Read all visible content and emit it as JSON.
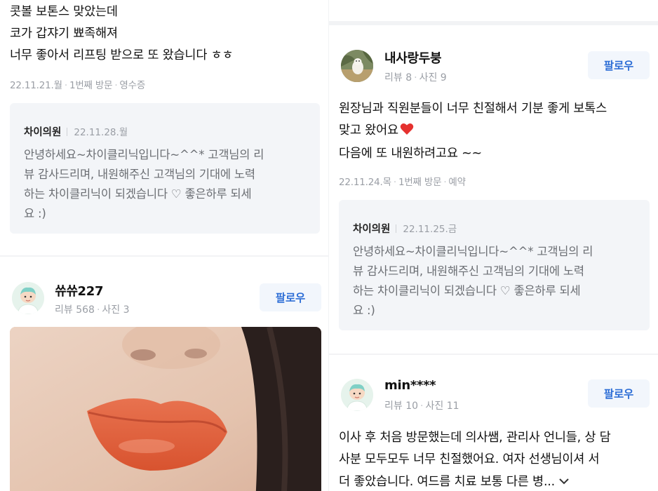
{
  "left": {
    "review1": {
      "lines": [
        "콧볼 보톤스 맞았는데",
        "코가 갑쟈기 뾰족해져",
        "너무 좋아서 리프팅 받으로 또 왔습니다 ㅎㅎ"
      ],
      "date": "22.11.21.월",
      "visit": "1번째 방문",
      "receipt": "영수증",
      "reply": {
        "author": "차이의원",
        "date": "22.11.28.월",
        "lines": [
          "안녕하세요~차이클리닉입니다~^^* 고객님의 리",
          "뷰 감사드리며, 내원해주신 고객님의 기대에 노력",
          "하는 차이클리닉이 되겠습니다 ♡ 좋은하루 되세",
          "요 :)"
        ]
      }
    },
    "reviewer2": {
      "name": "쓔쓔227",
      "reviews": "리뷰 568",
      "photos": "사진 3",
      "follow": "팔로우",
      "avatar_icon": "default-avatar-icon"
    }
  },
  "right": {
    "reviewer1": {
      "name": "내사랑두붕",
      "reviews": "리뷰 8",
      "photos": "사진 9",
      "follow": "팔로우",
      "avatar_icon": "dog-photo-avatar",
      "lines": [
        "원장님과 직원분들이 너무 친절해서 기분 좋게 보톡스",
        "맞고 왔어요",
        "다음에 또 내원하려고요 ~~"
      ],
      "date": "22.11.24.목",
      "visit": "1번째 방문",
      "booking": "예약",
      "reply": {
        "author": "차이의원",
        "date": "22.11.25.금",
        "lines": [
          "안녕하세요~차이클리닉입니다~^^* 고객님의 리",
          "뷰 감사드리며, 내원해주신 고객님의 기대에 노력",
          "하는 차이클리닉이 되겠습니다 ♡ 좋은하루 되세",
          "요 :)"
        ]
      }
    },
    "reviewer2": {
      "name": "min****",
      "reviews": "리뷰 10",
      "photos": "사진 11",
      "follow": "팔로우",
      "avatar_icon": "default-avatar-icon",
      "lines": [
        "이사 후 처음 방문했는데 의사쌤, 관리사 언니들, 상 담",
        "사분 모두모두 너무 친절했어요. 여자 선생님이셔 서",
        "더 좋았습니다. 여드름 치료 보통 다른 병..."
      ]
    }
  },
  "colors": {
    "accent": "#2f6fd6",
    "follow_bg": "#f2f6fc",
    "reply_bg": "#f3f5f8",
    "heart": "#e5312f"
  }
}
